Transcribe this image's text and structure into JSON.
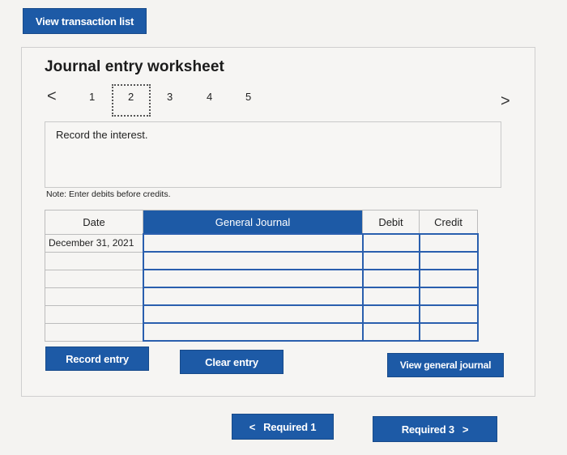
{
  "header": {
    "view_transaction_label": "View transaction list"
  },
  "worksheet": {
    "title": "Journal entry worksheet",
    "steps": [
      "1",
      "2",
      "3",
      "4",
      "5"
    ],
    "selected_step": "2",
    "prev_icon": "<",
    "next_icon": ">",
    "requirement_text": "Record the interest.",
    "note": "Note: Enter debits before credits."
  },
  "table": {
    "columns": [
      "Date",
      "General Journal",
      "Debit",
      "Credit"
    ],
    "rows": [
      {
        "date": "December 31, 2021",
        "account": "",
        "debit": "",
        "credit": ""
      },
      {
        "date": "",
        "account": "",
        "debit": "",
        "credit": ""
      },
      {
        "date": "",
        "account": "",
        "debit": "",
        "credit": ""
      },
      {
        "date": "",
        "account": "",
        "debit": "",
        "credit": ""
      },
      {
        "date": "",
        "account": "",
        "debit": "",
        "credit": ""
      },
      {
        "date": "",
        "account": "",
        "debit": "",
        "credit": ""
      }
    ]
  },
  "actions": {
    "record_entry": "Record entry",
    "clear_entry": "Clear entry",
    "view_general_journal": "View general journal"
  },
  "footer": {
    "prev_label": "Required 1",
    "next_label": "Required 3",
    "prev_icon": "<",
    "next_icon": ">"
  },
  "colors": {
    "primary": "#1d5aa6",
    "panel": "#f6f5f3"
  }
}
